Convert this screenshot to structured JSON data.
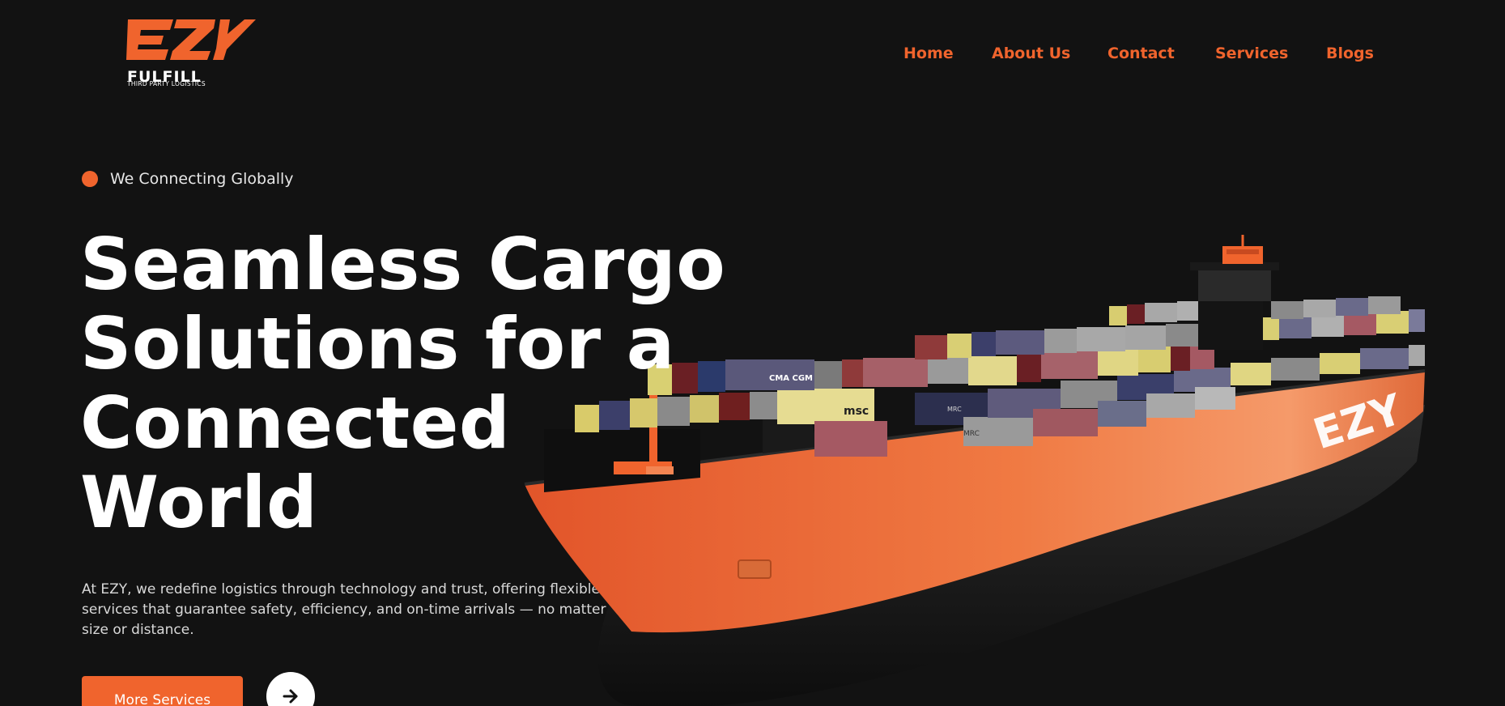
{
  "brand": {
    "logo_mark": "EZY",
    "logo_word": "FULFILL",
    "logo_sub": "THIRD PARTY LOGISTICS",
    "accent": "#f0642d",
    "background": "#121212"
  },
  "nav": {
    "items": [
      {
        "label": "Home"
      },
      {
        "label": "About Us"
      },
      {
        "label": "Contact"
      },
      {
        "label": "Services"
      },
      {
        "label": "Blogs"
      }
    ]
  },
  "hero": {
    "tagline": "We Connecting Globally",
    "title_lines": [
      "Seamless Cargo",
      "Solutions for a",
      "Connected",
      "World"
    ],
    "description": "At EZY, we redefine logistics through technology and trust, offering flexible cargo services that guarantee safety, efficiency, and on-time arrivals — no matter the size or distance.",
    "primary_button": "More Services",
    "arrow_icon": "arrow-right-icon"
  },
  "ship": {
    "hull_logo": "EZY",
    "container_labels": [
      "CMA CGM",
      "msc",
      "MRC"
    ]
  }
}
